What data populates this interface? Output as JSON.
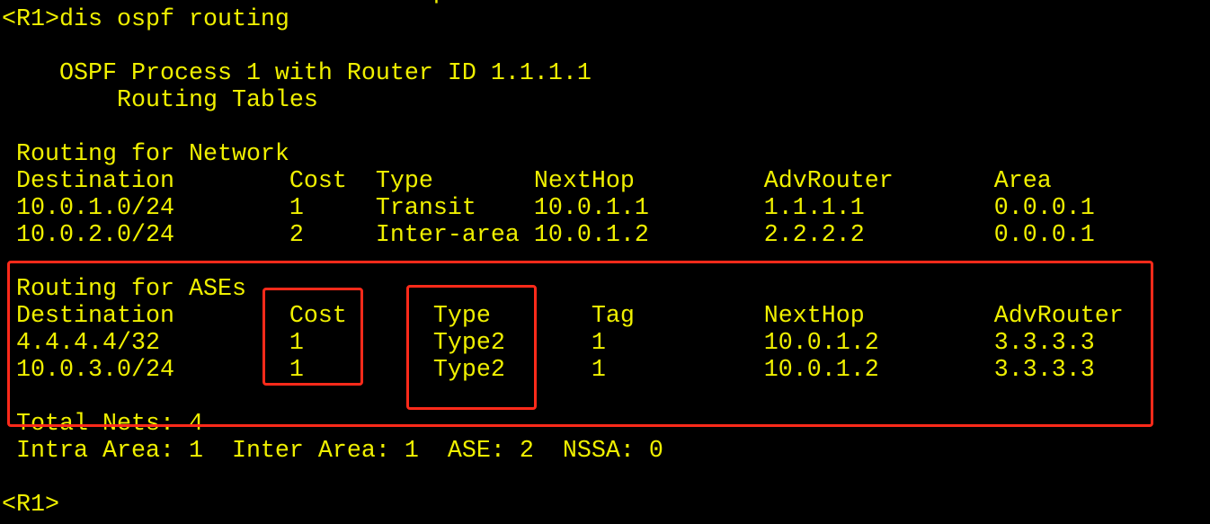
{
  "terminal": {
    "text_color": "#f0f000",
    "background": "#000000",
    "command_line": "<R1>dis ospf routing",
    "header": {
      "process": "    OSPF Process 1 with Router ID 1.1.1.1",
      "subtitle": "        Routing Tables"
    },
    "network_section": {
      "title": " Routing for Network",
      "header": " Destination        Cost  Type       NextHop         AdvRouter       Area",
      "rows": [
        " 10.0.1.0/24        1     Transit    10.0.1.1        1.1.1.1         0.0.0.1",
        " 10.0.2.0/24        2     Inter-area 10.0.1.2        2.2.2.2         0.0.0.1"
      ]
    },
    "ase_section": {
      "title": " Routing for ASEs",
      "header": " Destination        Cost      Type       Tag         NextHop         AdvRouter",
      "rows": [
        " 4.4.4.4/32         1         Type2      1           10.0.1.2        3.3.3.3",
        " 10.0.3.0/24        1         Type2      1           10.0.1.2        3.3.3.3"
      ]
    },
    "summary": {
      "total": " Total Nets: 4",
      "breakdown": " Intra Area: 1  Inter Area: 1  ASE: 2  NSSA: 0"
    },
    "prompt": "<R1>"
  },
  "annotations": {
    "highlight_color": "#ff2a1a"
  }
}
